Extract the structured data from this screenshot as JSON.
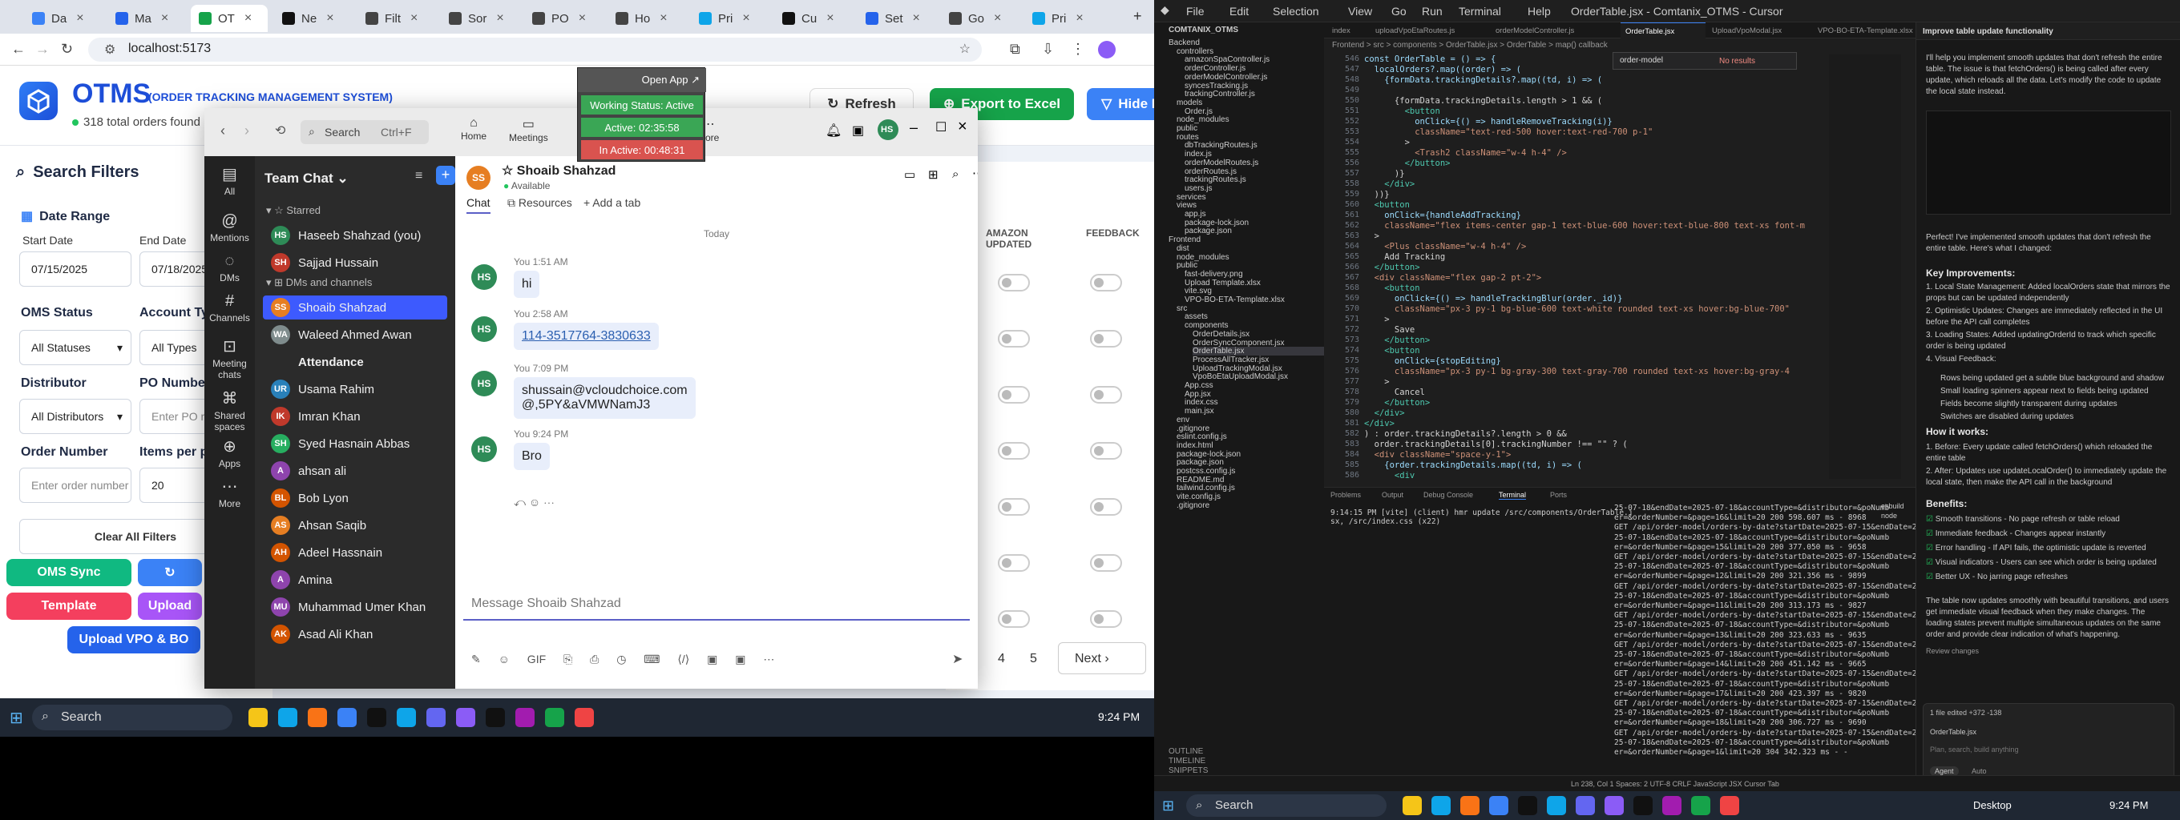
{
  "left_screen": {
    "browser": {
      "tabs": [
        {
          "label": "Da",
          "color": "#3b82f6"
        },
        {
          "label": "Ma",
          "color": "#2563eb"
        },
        {
          "label": "OT",
          "color": "#16a34a"
        },
        {
          "label": "Ne",
          "color": "#111111"
        },
        {
          "label": "Filt",
          "color": "#444444"
        },
        {
          "label": "Sor",
          "color": "#444444"
        },
        {
          "label": "PO",
          "color": "#444444"
        },
        {
          "label": "Ho",
          "color": "#444444"
        },
        {
          "label": "Pri",
          "color": "#0ea5e9"
        },
        {
          "label": "Cu",
          "color": "#111111"
        },
        {
          "label": "Set",
          "color": "#2563eb"
        },
        {
          "label": "Go",
          "color": "#444444"
        },
        {
          "label": "Pri",
          "color": "#0ea5e9"
        }
      ],
      "url": "localhost:5173"
    },
    "otms": {
      "title": "OTMS",
      "subtitle": "(ORDER TRACKING MANAGEMENT SYSTEM)",
      "orders_found": "318 total orders found",
      "refresh": "Refresh",
      "export": "Export to Excel",
      "hide_filters": "Hide Filters",
      "search_filters": "Search Filters",
      "date_range": "Date Range",
      "start_date_label": "Start Date",
      "start_date": "07/15/2025",
      "end_date_label": "End Date",
      "end_date": "07/18/2025",
      "oms_status_label": "OMS Status",
      "oms_status": "All Statuses",
      "account_type_label": "Account Type",
      "account_type": "All Types",
      "distributor_label": "Distributor",
      "distributor": "All Distributors",
      "po_number_label": "PO Number",
      "po_placeholder": "Enter PO nu",
      "order_number_label": "Order Number",
      "order_placeholder": "Enter order number",
      "items_per_page_label": "Items per pa",
      "items_per_page": "20",
      "clear_filters": "Clear All Filters",
      "oms_sync": "OMS Sync",
      "template": "Template",
      "upload": "Upload",
      "upload_vpo": "Upload VPO & BO",
      "col_amazon": "AMAZON UPDATED",
      "col_feedback": "FEEDBACK",
      "pages": [
        "4",
        "5"
      ],
      "next": "Next"
    },
    "status_popup": {
      "open_app": "Open App ↗",
      "working": "Working Status: Active",
      "active": "Active: 02:35:58",
      "inactive": "In Active: 00:48:31"
    },
    "teams": {
      "search_placeholder": "Search",
      "shortcut": "Ctrl+F",
      "top_nav": [
        "Home",
        "Meetings",
        "More"
      ],
      "rail": [
        "All",
        "Mentions",
        "DMs",
        "Channels",
        "Meeting chats",
        "Shared spaces",
        "Apps",
        "More"
      ],
      "list_title": "Team Chat",
      "starred": "Starred",
      "dms_section": "DMs and channels",
      "starred_items": [
        {
          "initials": "HS",
          "name": "Haseeb Shahzad (you)",
          "color": "#2e8b57"
        },
        {
          "initials": "SH",
          "name": "Sajjad Hussain",
          "color": "#c0392b"
        }
      ],
      "dm_items": [
        {
          "initials": "SS",
          "name": "Shoaib Shahzad",
          "color": "#e67e22"
        },
        {
          "initials": "WA",
          "name": "Waleed Ahmed Awan",
          "color": "#7f8c8d"
        },
        {
          "initials": "",
          "name": "Attendance",
          "color": "#2b2b2b"
        },
        {
          "initials": "UR",
          "name": "Usama Rahim",
          "color": "#2980b9"
        },
        {
          "initials": "IK",
          "name": "Imran Khan",
          "color": "#c0392b"
        },
        {
          "initials": "SH",
          "name": "Syed Hasnain Abbas",
          "color": "#27ae60"
        },
        {
          "initials": "A",
          "name": "ahsan ali",
          "color": "#8e44ad"
        },
        {
          "initials": "BL",
          "name": "Bob Lyon",
          "color": "#d35400"
        },
        {
          "initials": "AS",
          "name": "Ahsan Saqib",
          "color": "#e67e22"
        },
        {
          "initials": "AH",
          "name": "Adeel Hassnain",
          "color": "#d35400"
        },
        {
          "initials": "A",
          "name": "Amina",
          "color": "#8e44ad"
        },
        {
          "initials": "MU",
          "name": "Muhammad Umer Khan",
          "color": "#8e44ad"
        },
        {
          "initials": "AK",
          "name": "Asad Ali Khan",
          "color": "#d35400"
        }
      ],
      "chat_name": "Shoaib Shahzad",
      "chat_status": "Available",
      "chat_tabs": [
        "Chat",
        "Resources",
        "Add a tab"
      ],
      "day": "Today",
      "messages": [
        {
          "sender": "You",
          "time": "1:51 AM",
          "text": "hi"
        },
        {
          "sender": "You",
          "time": "2:58 AM",
          "text": "114-3517764-3830633"
        },
        {
          "sender": "You",
          "time": "7:09 PM",
          "text": "shussain@vcloudchoice.com\n@,5PY&aVMWNamJ3"
        },
        {
          "sender": "You",
          "time": "9:24 PM",
          "text": "Bro"
        }
      ],
      "compose_placeholder": "Message Shoaib Shahzad"
    },
    "taskbar": {
      "search": "Search",
      "time": "9:24 PM"
    }
  },
  "right_screen": {
    "title": "OrderTable.jsx - Comtanix_OTMS - Cursor",
    "menu": [
      "File",
      "Edit",
      "Selection",
      "View",
      "Go",
      "Run",
      "Terminal",
      "Help"
    ],
    "editor_tabs": [
      "index",
      "uploadVpoEtaRoutes.js",
      "orderModelController.js",
      "OrderTable.jsx",
      "UploadVpoModal.jsx",
      "VPO-BO-ETA-Template.xlsx"
    ],
    "breadcrumb": "Frontend > src > components > OrderTable.jsx > OrderTable > map() callback",
    "find_widget": "order-model",
    "find_result": "No results",
    "explorer_title": "COMTANIX_OTMS",
    "explorer_items": [
      "Backend",
      "controllers",
      "amazonSpaController.js",
      "orderController.js",
      "orderModelController.js",
      "syncesTracking.js",
      "trackingController.js",
      "models",
      "Order.js",
      "node_modules",
      "public",
      "routes",
      "dbTrackingRoutes.js",
      "index.js",
      "orderModelRoutes.js",
      "orderRoutes.js",
      "trackingRoutes.js",
      "users.js",
      "services",
      "views",
      "app.js",
      "package-lock.json",
      "package.json",
      "Frontend",
      "dist",
      "node_modules",
      "public",
      "fast-delivery.png",
      "Upload Template.xlsx",
      "vite.svg",
      "VPO-BO-ETA-Template.xlsx",
      "src",
      "assets",
      "components",
      "OrderDetails.jsx",
      "OrderSyncComponent.jsx",
      "OrderTable.jsx",
      "ProcessAllTracker.jsx",
      "UploadTrackingModal.jsx",
      "VpoBoEtaUploadModal.jsx",
      "App.css",
      "App.jsx",
      "index.css",
      "main.jsx",
      "env",
      ".gitignore",
      "eslint.config.js",
      "index.html",
      "package-lock.json",
      "package.json",
      "postcss.config.js",
      "README.md",
      "tailwind.config.js",
      "vite.config.js",
      ".gitignore"
    ],
    "outline": [
      "OUTLINE",
      "TIMELINE",
      "SNIPPETS"
    ],
    "code_start_line": 546,
    "code_lines": [
      "const OrderTable = () => {",
      "  localOrders?.map((order) => (",
      "    {formData.trackingDetails?.map((td, i) => (",
      "",
      "      {formData.trackingDetails.length > 1 && (",
      "        <button",
      "          onClick={() => handleRemoveTracking(i)}",
      "          className=\"text-red-500 hover:text-red-700 p-1\"",
      "        >",
      "          <Trash2 className=\"w-4 h-4\" />",
      "        </button>",
      "      )}",
      "    </div>",
      "  ))}",
      "  <button",
      "    onClick={handleAddTracking}",
      "    className=\"flex items-center gap-1 text-blue-600 hover:text-blue-800 text-xs font-m",
      "  >",
      "    <Plus className=\"w-4 h-4\" />",
      "    Add Tracking",
      "  </button>",
      "  <div className=\"flex gap-2 pt-2\">",
      "    <button",
      "      onClick={() => handleTrackingBlur(order._id)}",
      "      className=\"px-3 py-1 bg-blue-600 text-white rounded text-xs hover:bg-blue-700\"",
      "    >",
      "      Save",
      "    </button>",
      "    <button",
      "      onClick={stopEditing}",
      "      className=\"px-3 py-1 bg-gray-300 text-gray-700 rounded text-xs hover:bg-gray-4",
      "    >",
      "      Cancel",
      "    </button>",
      "  </div>",
      "</div>",
      ") : order.trackingDetails?.length > 0 &&",
      "  order.trackingDetails[0].trackingNumber !== \"\" ? (",
      "  <div className=\"space-y-1\">",
      "    {order.trackingDetails.map((td, i) => (",
      "      <div"
    ],
    "panel_tabs": [
      "Problems",
      "Output",
      "Debug Console",
      "Terminal",
      "Ports"
    ],
    "term_left": [
      "9:14:15 PM [vite] (client) hmr update /src/components/OrderTable.j",
      "sx, /src/index.css (x22)"
    ],
    "term_right": [
      "25-07-18&endDate=2025-07-18&accountType=&distributor=&poNumb",
      "er=&orderNumber=&page=16&limit=20 200 598.607 ms - 8968",
      "GET /api/order-model/orders-by-date?startDate=2025-07-15&endDate=20",
      "25-07-18&endDate=2025-07-18&accountType=&distributor=&poNumb",
      "er=&orderNumber=&page=15&limit=20 200 377.050 ms - 9658",
      "GET /api/order-model/orders-by-date?startDate=2025-07-15&endDate=20",
      "25-07-18&endDate=2025-07-18&accountType=&distributor=&poNumb",
      "er=&orderNumber=&page=12&limit=20 200 321.356 ms - 9899",
      "GET /api/order-model/orders-by-date?startDate=2025-07-15&endDate=20",
      "25-07-18&endDate=2025-07-18&accountType=&distributor=&poNumb",
      "er=&orderNumber=&page=11&limit=20 200 313.173 ms - 9827",
      "GET /api/order-model/orders-by-date?startDate=2025-07-15&endDate=20",
      "25-07-18&endDate=2025-07-18&accountType=&distributor=&poNumb",
      "er=&orderNumber=&page=13&limit=20 200 323.633 ms - 9635",
      "GET /api/order-model/orders-by-date?startDate=2025-07-15&endDate=20",
      "25-07-18&endDate=2025-07-18&accountType=&distributor=&poNumb",
      "er=&orderNumber=&page=14&limit=20 200 451.142 ms - 9665",
      "GET /api/order-model/orders-by-date?startDate=2025-07-15&endDate=20",
      "25-07-18&endDate=2025-07-18&accountType=&distributor=&poNumb",
      "er=&orderNumber=&page=17&limit=20 200 423.397 ms - 9820",
      "GET /api/order-model/orders-by-date?startDate=2025-07-15&endDate=20",
      "25-07-18&endDate=2025-07-18&accountType=&distributor=&poNumb",
      "er=&orderNumber=&page=18&limit=20 200 306.727 ms - 9690",
      "GET /api/order-model/orders-by-date?startDate=2025-07-15&endDate=20",
      "25-07-18&endDate=2025-07-18&accountType=&distributor=&poNumb",
      "er=&orderNumber=&page=1&limit=20 304 342.323 ms - -"
    ],
    "term_sessions": [
      "esbuild",
      "node"
    ],
    "chat_panel": {
      "title": "Improve table update functionality",
      "intro": "I'll help you implement smooth updates that don't refresh the entire table. The issue is that fetchOrders() is being called after every update, which reloads all the data. Let's modify the code to update the local state instead.",
      "done": "Perfect! I've implemented smooth updates that don't refresh the entire table. Here's what I changed:",
      "h1": "Key Improvements:",
      "improvements": [
        "1. Local State Management: Added localOrders state that mirrors the props but can be updated independently",
        "2. Optimistic Updates: Changes are immediately reflected in the UI before the API call completes",
        "3. Loading States: Added updatingOrderId to track which specific order is being updated",
        "4. Visual Feedback:"
      ],
      "visual": [
        "Rows being updated get a subtle blue background and shadow",
        "Small loading spinners appear next to fields being updated",
        "Fields become slightly transparent during updates",
        "Switches are disabled during updates"
      ],
      "h2": "How it works:",
      "how": [
        "1. Before: Every update called fetchOrders() which reloaded the entire table",
        "2. After: Updates use updateLocalOrder() to immediately update the local state, then make the API call in the background"
      ],
      "h3": "Benefits:",
      "benefits": [
        "Smooth transitions - No page refresh or table reload",
        "Immediate feedback - Changes appear instantly",
        "Error handling - If API fails, the optimistic update is reverted",
        "Visual indicators - Users can see which order is being updated",
        "Better UX - No jarring page refreshes"
      ],
      "outro": "The table now updates smoothly with beautiful transitions, and users get immediate visual feedback when they make changes. The loading states prevent multiple simultaneous updates on the same order and provide clear indication of what's happening.",
      "review": "Review changes",
      "files_edited": "1 file edited +372 -138",
      "file": "OrderTable.jsx",
      "input_placeholder": "Plan, search, build anything",
      "agent": "Agent",
      "auto": "Auto"
    },
    "statusbar": "Ln 238, Col 1   Spaces: 2   UTF-8   CRLF   JavaScript JSX   Cursor Tab",
    "taskbar": {
      "search": "Search",
      "desktop": "Desktop",
      "time": "9:24 PM"
    }
  }
}
